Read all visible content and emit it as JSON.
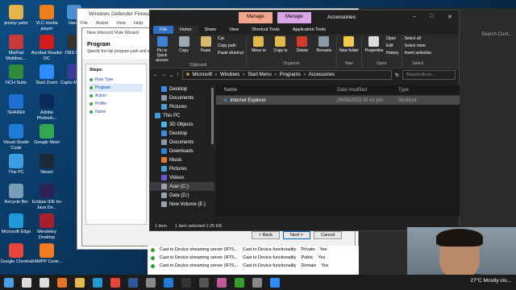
{
  "desktop": {
    "icons": [
      {
        "label": "jessoy yator",
        "color": "#e6b24a"
      },
      {
        "label": "VLC media player",
        "color": "#f07f1a"
      },
      {
        "label": "Handl",
        "color": "#4a8fd6"
      },
      {
        "label": "MisPad Multitrac...",
        "color": "#c83a3a"
      },
      {
        "label": "Acrobat Reader DC",
        "color": "#d21b1b"
      },
      {
        "label": "OBS St...",
        "color": "#333333"
      },
      {
        "label": "NCH Suite",
        "color": "#2f8a3b"
      },
      {
        "label": "Start Zoom",
        "color": "#2d8cff"
      },
      {
        "label": "Captu Mock...",
        "color": "#3b3b9a"
      },
      {
        "label": "SHAREit",
        "color": "#1f6fd1"
      },
      {
        "label": "Adobe Photosh...",
        "color": "#0a2a5a"
      },
      {
        "label": "Visual Studio Code",
        "color": "#1f7bd6"
      },
      {
        "label": "Google Meet",
        "color": "#2fa84f"
      },
      {
        "label": "This PC",
        "color": "#3a9ee0"
      },
      {
        "label": "Steam",
        "color": "#1b2838"
      },
      {
        "label": "Recycle Bin",
        "color": "#7a9bb5"
      },
      {
        "label": "Eclipse IDE for Java De...",
        "color": "#2c2255"
      },
      {
        "label": "Microsoft Edge",
        "color": "#1f9ad6"
      },
      {
        "label": "Mendeley Desktop",
        "color": "#a91f2a"
      },
      {
        "label": "Google Chrome",
        "color": "#e8443a"
      },
      {
        "label": "XAMPP Contr...",
        "color": "#f47a20"
      }
    ]
  },
  "defender": {
    "title": "Windows Defender Firewall",
    "menu": [
      "File",
      "Action",
      "View",
      "Help"
    ]
  },
  "wizard": {
    "title": "New Inbound Rule Wizard",
    "heading": "Program",
    "description": "Specify the full program path and exe",
    "steps_title": "Steps:",
    "steps": [
      "Rule Type",
      "Program",
      "Action",
      "Profile",
      "Name"
    ],
    "back": "< Back",
    "next": "Next >",
    "cancel": "Cancel"
  },
  "rules": [
    {
      "name": "Cast to Device streaming server (RTS...",
      "group": "Cast to Device functionality",
      "profile": "Private",
      "enabled": "Yes"
    },
    {
      "name": "Cast to Device streaming server (RTS...",
      "group": "Cast to Device functionality",
      "profile": "Public",
      "enabled": "Yes"
    },
    {
      "name": "Cast to Device streaming server (RTS...",
      "group": "Cast to Device functionality",
      "profile": "Domain",
      "enabled": "Yes"
    }
  ],
  "right_panel": {
    "search_placeholder": "Search Cont..."
  },
  "explorer": {
    "context_tab_1": "Manage",
    "context_tab_2": "Manage",
    "window_title": "Accessories",
    "tabs": [
      "File",
      "Home",
      "Share",
      "View",
      "Shortcut Tools",
      "Application Tools"
    ],
    "ribbon": {
      "clipboard": {
        "pin": "Pin to Quick access",
        "copy": "Copy",
        "paste": "Paste",
        "cut": "Cut",
        "copy_path": "Copy path",
        "paste_shortcut": "Paste shortcut",
        "label": "Clipboard"
      },
      "organize": {
        "move_to": "Move to",
        "copy_to": "Copy to",
        "delete": "Delete",
        "rename": "Rename",
        "label": "Organize"
      },
      "new": {
        "new_folder": "New folder",
        "label": "New"
      },
      "open": {
        "properties": "Properties",
        "open": "Open",
        "edit": "Edit",
        "history": "History",
        "label": "Open"
      },
      "select": {
        "select_all": "Select all",
        "select_none": "Select none",
        "invert": "Invert selection",
        "label": "Select"
      }
    },
    "path": [
      "Microsoft",
      "Windows",
      "Start Menu",
      "Programs",
      "Accessories"
    ],
    "search_placeholder": "Search Acce...",
    "nav": [
      {
        "label": "Desktop",
        "color": "#3a8ee6",
        "level": "child"
      },
      {
        "label": "Documents",
        "color": "#8a9aaa",
        "level": "child"
      },
      {
        "label": "Pictures",
        "color": "#4aa0d8",
        "level": "child"
      },
      {
        "label": "This PC",
        "color": "#3a9ee0",
        "level": "root"
      },
      {
        "label": "3D Objects",
        "color": "#4bb5e6",
        "level": "child"
      },
      {
        "label": "Desktop",
        "color": "#3a8ee6",
        "level": "child"
      },
      {
        "label": "Documents",
        "color": "#8a9aaa",
        "level": "child"
      },
      {
        "label": "Downloads",
        "color": "#2f7fd1",
        "level": "child"
      },
      {
        "label": "Music",
        "color": "#e07a30",
        "level": "child"
      },
      {
        "label": "Pictures",
        "color": "#4aa0d8",
        "level": "child"
      },
      {
        "label": "Videos",
        "color": "#6a5acd",
        "level": "child"
      },
      {
        "label": "Acer (C:)",
        "color": "#9aa3ad",
        "level": "child",
        "selected": true
      },
      {
        "label": "Data (D:)",
        "color": "#9aa3ad",
        "level": "child"
      },
      {
        "label": "New Volume (E:)",
        "color": "#9aa3ad",
        "level": "child"
      }
    ],
    "columns": {
      "name": "Name",
      "date": "Date modified",
      "type": "Type"
    },
    "files": [
      {
        "name": "Internet Explorer",
        "date": "26/05/2023 10:41 pm",
        "type": "Shortcut"
      }
    ],
    "status": {
      "count": "1 item",
      "selected": "1 item selected  1.25 KB"
    }
  },
  "taskbar": {
    "icons": [
      "windows-icon",
      "search-icon",
      "task-view-icon",
      "firefox-icon",
      "explorer-icon",
      "edge-icon",
      "chrome-icon",
      "word-icon",
      "settings-icon",
      "vscode-icon",
      "terminal-icon",
      "store-icon",
      "paint-icon",
      "defender-icon",
      "camera-icon",
      "zoom-icon"
    ],
    "weather": "27°C  Mostly clo..."
  }
}
